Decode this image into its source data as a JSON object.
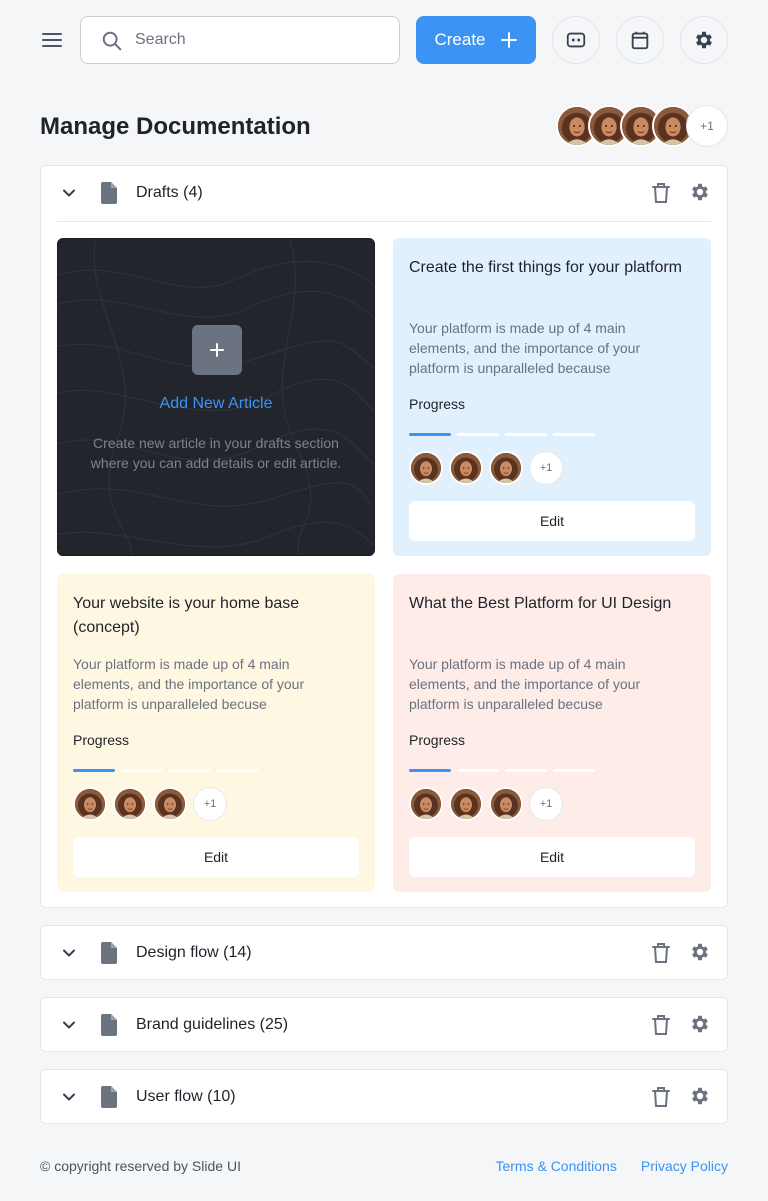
{
  "search": {
    "placeholder": "Search",
    "value": ""
  },
  "toolbar": {
    "create_label": "Create"
  },
  "page": {
    "title": "Manage Documentation"
  },
  "team": {
    "more_label": "+1"
  },
  "sections": [
    {
      "label": "Drafts (4)",
      "expanded": true
    },
    {
      "label": "Design flow (14)",
      "expanded": false
    },
    {
      "label": "Brand guidelines (25)",
      "expanded": false
    },
    {
      "label": "User flow (10)",
      "expanded": false
    }
  ],
  "add_article": {
    "title": "Add New Article",
    "description": "Create new article in your drafts section where you can add details or edit article."
  },
  "cards": [
    {
      "title": "Create the first things for your platform",
      "description": "Your platform is made up of 4 main elements, and the importance of your platform is unparalleled because",
      "progress_label": "Progress",
      "progress_steps_done": 1,
      "progress_steps_total": 4,
      "more_label": "+1",
      "edit_label": "Edit",
      "color": "#e1f0fd"
    },
    {
      "title": "Your website is your home base (concept)",
      "description": "Your platform is made up of 4 main elements, and the importance of your platform is unparalleled becuse",
      "progress_label": "Progress",
      "progress_steps_done": 1,
      "progress_steps_total": 4,
      "more_label": "+1",
      "edit_label": "Edit",
      "color": "#fef8e2"
    },
    {
      "title": "What the Best Platform for UI Design",
      "description": "Your platform is made up of 4 main elements, and the importance of your platform is unparalleled becuse",
      "progress_label": "Progress",
      "progress_steps_done": 1,
      "progress_steps_total": 4,
      "more_label": "+1",
      "edit_label": "Edit",
      "color": "#fdece8"
    }
  ],
  "footer": {
    "copyright": "© copyright reserved by Slide UI",
    "terms": "Terms & Conditions",
    "privacy": "Privacy Policy"
  },
  "colors": {
    "accent": "#3b93f3",
    "dark_card": "#22262c"
  },
  "icons": [
    "menu-icon",
    "search-icon",
    "plus-icon",
    "chat-icon",
    "calendar-icon",
    "gear-icon",
    "chevron-down-icon",
    "document-icon",
    "trash-icon"
  ]
}
